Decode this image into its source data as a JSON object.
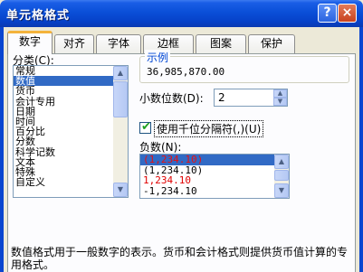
{
  "window": {
    "title": "单元格格式",
    "help_label": "?",
    "close_label": "×"
  },
  "tabs": [
    "数字",
    "对齐",
    "字体",
    "边框",
    "图案",
    "保护"
  ],
  "category": {
    "label": "分类(C):",
    "items": [
      "常规",
      "数值",
      "货币",
      "会计专用",
      "日期",
      "时间",
      "百分比",
      "分数",
      "科学记数",
      "文本",
      "特殊",
      "自定义"
    ],
    "selected_index": 1
  },
  "sample": {
    "title": "示例",
    "value": "36,985,870.00"
  },
  "decimal": {
    "label": "小数位数(D):",
    "value": "2"
  },
  "thousands": {
    "label": "使用千位分隔符(,)(U)",
    "checked": true
  },
  "negative": {
    "label": "负数(N):",
    "items": [
      "(1,234.10)",
      "(1,234.10)",
      "1,234.10",
      "-1,234.10"
    ],
    "selected_index": 0
  },
  "description": "数值格式用于一般数字的表示。货币和会计格式则提供货币值计算的专用格式。",
  "icons": {
    "scroll_up": "▲",
    "scroll_down": "▼",
    "spin_up": "▲",
    "spin_down": "▼",
    "check": "✔"
  }
}
